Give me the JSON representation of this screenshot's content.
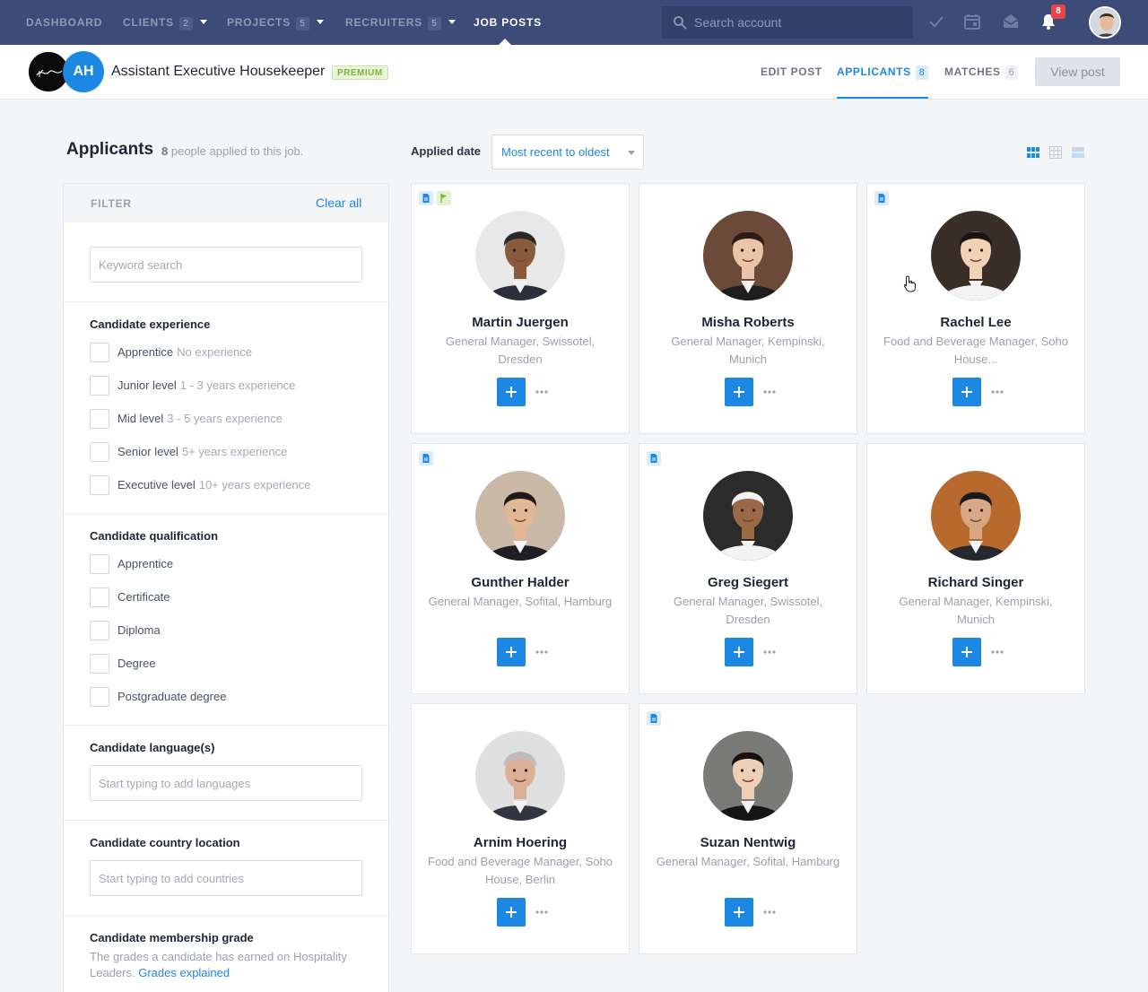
{
  "nav": {
    "items": [
      {
        "label": "DASHBOARD",
        "badge": null,
        "dropdown": false
      },
      {
        "label": "CLIENTS",
        "badge": "2",
        "dropdown": true
      },
      {
        "label": "PROJECTS",
        "badge": "5",
        "dropdown": true
      },
      {
        "label": "RECRUITERS",
        "badge": "5",
        "dropdown": true
      },
      {
        "label": "JOB POSTS",
        "badge": null,
        "dropdown": false
      }
    ],
    "active": "JOB POSTS",
    "search_placeholder": "Search account",
    "notification_count": "8",
    "icons": [
      "check-icon",
      "calendar-icon",
      "mail-icon",
      "bell-icon"
    ]
  },
  "job": {
    "logo_initials": "AH",
    "logo_script": "Kempinski",
    "title": "Assistant Executive Housekeeper",
    "badge": "PREMIUM"
  },
  "tabs": [
    {
      "label": "EDIT POST",
      "count": null
    },
    {
      "label": "APPLICANTS",
      "count": "8"
    },
    {
      "label": "MATCHES",
      "count": "6"
    }
  ],
  "active_tab": "APPLICANTS",
  "view_post_label": "View post",
  "applicants": {
    "heading": "Applicants",
    "count": "8",
    "subtext": "people applied to this job."
  },
  "sort": {
    "label": "Applied date",
    "value": "Most recent to oldest"
  },
  "filter": {
    "title": "FILTER",
    "clear_all": "Clear all",
    "keyword_placeholder": "Keyword search",
    "experience": {
      "title": "Candidate experience",
      "options": [
        {
          "label": "Apprentice",
          "sub": "No experience"
        },
        {
          "label": "Junior level",
          "sub": "1 - 3 years experience"
        },
        {
          "label": "Mid level",
          "sub": "3 - 5 years experience"
        },
        {
          "label": "Senior level",
          "sub": "5+ years experience"
        },
        {
          "label": "Executive level",
          "sub": "10+ years experience"
        }
      ]
    },
    "qualification": {
      "title": "Candidate qualification",
      "options": [
        "Apprentice",
        "Certificate",
        "Diploma",
        "Degree",
        "Postgraduate degree"
      ]
    },
    "languages": {
      "title": "Candidate language(s)",
      "placeholder": "Start typing to add languages"
    },
    "country": {
      "title": "Candidate country location",
      "placeholder": "Start typing to add countries"
    },
    "membership": {
      "title": "Candidate membership grade",
      "desc": "The grades a candidate has earned on Hospitality Leaders.",
      "link": "Grades explained"
    }
  },
  "candidates": [
    {
      "name": "Martin Juergen",
      "role": "General Manager, Swissotel, Dresden",
      "doc": true,
      "flag": true,
      "skin": "#8a5a3c",
      "hair": "#2a2a2a",
      "bg": "#e8e8e8",
      "suit": "#2b2f3a"
    },
    {
      "name": "Misha Roberts",
      "role": "General Manager, Kempinski, Munich",
      "doc": false,
      "flag": false,
      "skin": "#e9c4a8",
      "hair": "#2e1d14",
      "bg": "#6b4a3a",
      "suit": "#1e1e1e"
    },
    {
      "name": "Rachel Lee",
      "role": "Food and Beverage Manager, Soho House...",
      "doc": true,
      "flag": false,
      "skin": "#f0d2b6",
      "hair": "#1c140f",
      "bg": "#3a2f28",
      "suit": "#f4f4f4"
    },
    {
      "name": "Gunther Halder",
      "role": "General Manager, Sofital, Hamburg",
      "doc": true,
      "flag": false,
      "skin": "#e2b894",
      "hair": "#1f1a16",
      "bg": "#c9b9a6",
      "suit": "#1d1f24"
    },
    {
      "name": "Greg Siegert",
      "role": "General Manager, Swissotel, Dresden",
      "doc": true,
      "flag": false,
      "skin": "#9a6a46",
      "hair": "#f2f2f2",
      "bg": "#2b2b2b",
      "suit": "#f2f2f2"
    },
    {
      "name": "Richard Singer",
      "role": "General Manager, Kempinski, Munich",
      "doc": false,
      "flag": false,
      "skin": "#d8a884",
      "hair": "#1a1a1a",
      "bg": "#b86a2e",
      "suit": "#26282d"
    },
    {
      "name": "Arnim Hoering",
      "role": "Food and Beverage Manager, Soho House, Berlin",
      "doc": false,
      "flag": false,
      "skin": "#dcb096",
      "hair": "#bdbdbd",
      "bg": "#dfdfdf",
      "suit": "#30353f"
    },
    {
      "name": "Suzan Nentwig",
      "role": "General Manager, Sofital, Hamburg",
      "doc": true,
      "flag": false,
      "skin": "#eccfb5",
      "hair": "#161210",
      "bg": "#7a7a78",
      "suit": "#151515"
    }
  ],
  "colors": {
    "nav_bg": "#3d4b78",
    "accent": "#1d87e4",
    "premium": "#7ab43d",
    "notification": "#e8434b"
  }
}
